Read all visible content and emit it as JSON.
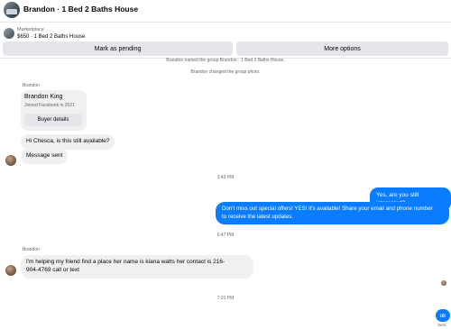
{
  "header": {
    "title": "Brandon · 1 Bed 2 Baths House"
  },
  "marketplace": {
    "label": "Marketplace",
    "listing": "$650 · 1 Bed 2 Baths House"
  },
  "actions": {
    "mark_pending": "Mark as pending",
    "more_options": "More options"
  },
  "system_messages": {
    "named_group": "Brandon named the group Brandon · 1 Bed 2 Baths House.",
    "changed_photo": "Brandon changed the group photo."
  },
  "buyer_card": {
    "sender": "Brandon",
    "name": "Brandon King",
    "joined": "Joined Facebook in 2021",
    "button": "Buyer details"
  },
  "messages": {
    "m1": "Hi Chesca, is this still available?",
    "m2": "Message sent",
    "time1": "3:43 PM",
    "m3": "Yes, are you still interested?",
    "m4_line1": "Don't miss out special offers! YES! it's available! Share your email and phone number",
    "m4_line2": "to receive the latest updates.",
    "time2": "6:47 PM",
    "sender2": "Brandon",
    "m5_line1": "I'm helping my friend find a place  her  name is  kiana  watts her contact is    216-",
    "m5_line2": "904-4769 call or text",
    "time3": "7:21 PM",
    "m6": "ok",
    "sent": "Sent"
  }
}
